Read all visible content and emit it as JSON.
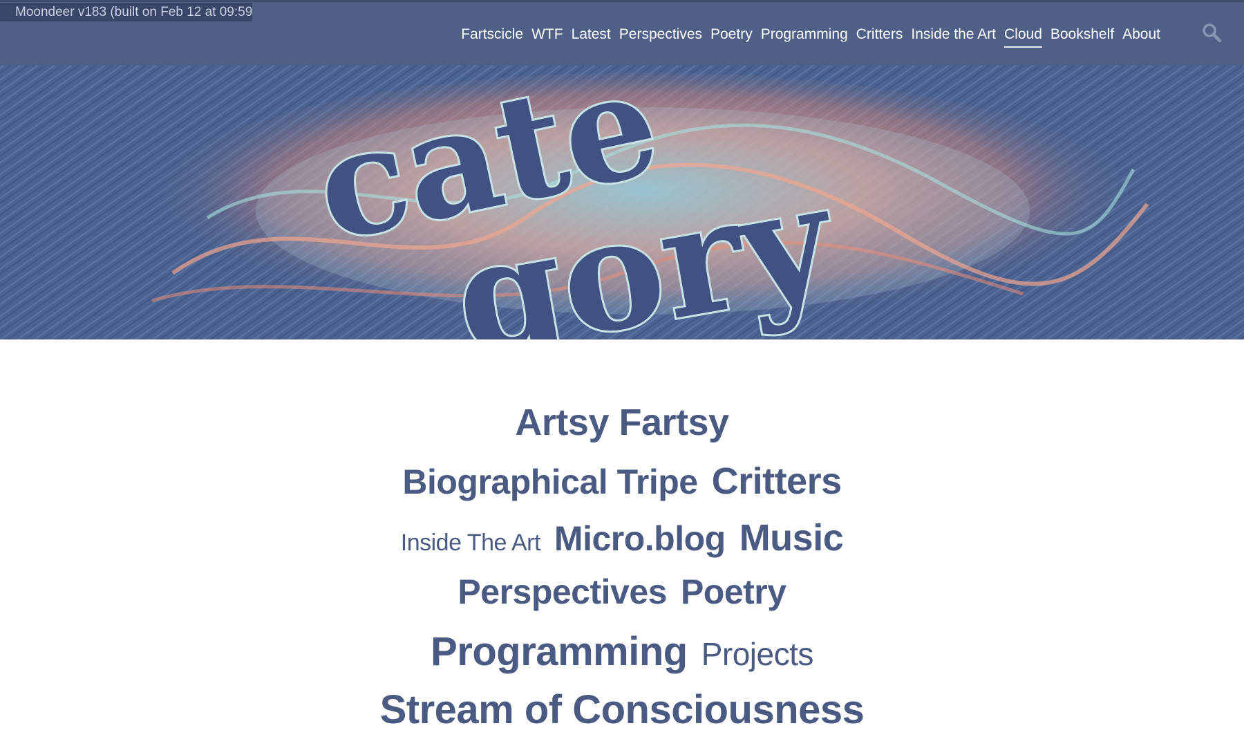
{
  "build_badge": "Moondeer v183 (built on Feb 12 at 09:59)",
  "colors": {
    "header_bg": "#4f5f86",
    "tag_text": "#4a5a82",
    "hero_bg": "#4b6391"
  },
  "nav": {
    "items": [
      {
        "label": "Fartscicle"
      },
      {
        "label": "WTF"
      },
      {
        "label": "Latest"
      },
      {
        "label": "Perspectives"
      },
      {
        "label": "Poetry"
      },
      {
        "label": "Programming"
      },
      {
        "label": "Critters"
      },
      {
        "label": "Inside the Art"
      },
      {
        "label": "Cloud",
        "active": true
      },
      {
        "label": "Bookshelf"
      },
      {
        "label": "About"
      }
    ],
    "search_icon": "search-icon"
  },
  "hero": {
    "word_line_1": "cate",
    "word_line_2": "gory"
  },
  "cloud": {
    "rows": [
      [
        {
          "label": "Artsy Fartsy",
          "weight": "l"
        }
      ],
      [
        {
          "label": "Biographical Tripe",
          "weight": "m"
        },
        {
          "label": "Critters",
          "weight": "l"
        }
      ],
      [
        {
          "label": "Inside The Art",
          "weight": "xs"
        },
        {
          "label": "Micro.blog",
          "weight": "m"
        },
        {
          "label": "Music",
          "weight": "l"
        }
      ],
      [
        {
          "label": "Perspectives",
          "weight": "m"
        },
        {
          "label": "Poetry",
          "weight": "m"
        }
      ],
      [
        {
          "label": "Programming",
          "weight": "xl"
        },
        {
          "label": "Projects",
          "weight": "s"
        }
      ],
      [
        {
          "label": "Stream of Consciousness",
          "weight": "xl"
        }
      ]
    ]
  }
}
